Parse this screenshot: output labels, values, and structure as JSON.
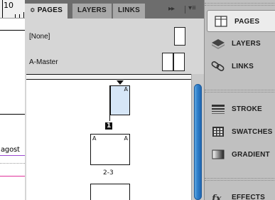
{
  "document": {
    "ruler_number": "10",
    "text_fragment": "agost"
  },
  "pages_panel": {
    "tabs": [
      {
        "label": "PAGES",
        "caret": "≎",
        "active": true
      },
      {
        "label": "LAYERS",
        "active": false
      },
      {
        "label": "LINKS",
        "active": false
      }
    ],
    "collapse_icon": "double-chevron-right",
    "menu_icon": "panel-menu",
    "masters": [
      {
        "label": "[None]",
        "thumbnail": "single-page"
      },
      {
        "label": "A-Master",
        "thumbnail": "two-page-spread"
      }
    ],
    "pages": [
      {
        "number": "1",
        "master_letter": "A",
        "selected": true,
        "layout": "single-right"
      },
      {
        "number": "2-3",
        "master_letters": [
          "A",
          "A"
        ],
        "selected": false,
        "layout": "spread"
      }
    ],
    "colors": {
      "selected_page": "#d6e6f7",
      "scroll_thumb": "#2f7fcb",
      "tabbar": "#6d6d6d",
      "panel_bg": "#d6d6d6"
    }
  },
  "dock": {
    "items": [
      {
        "label": "PAGES",
        "icon": "pages-icon",
        "active": true
      },
      {
        "label": "LAYERS",
        "icon": "layers-icon",
        "active": false
      },
      {
        "label": "LINKS",
        "icon": "links-icon",
        "active": false
      },
      {
        "label": "STROKE",
        "icon": "stroke-icon",
        "active": false
      },
      {
        "label": "SWATCHES",
        "icon": "swatches-icon",
        "active": false
      },
      {
        "label": "GRADIENT",
        "icon": "gradient-icon",
        "active": false
      },
      {
        "label": "EFFECTS",
        "icon": "effects-icon",
        "active": false
      }
    ]
  }
}
